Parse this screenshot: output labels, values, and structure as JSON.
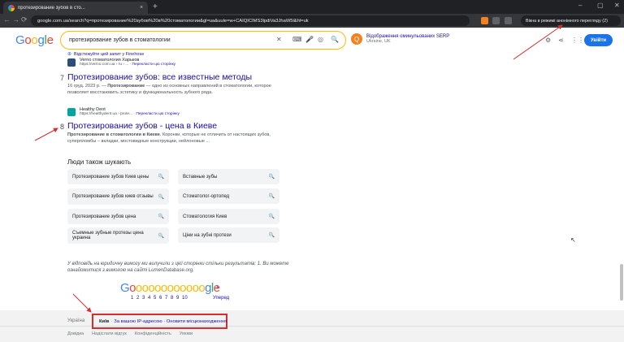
{
  "browser": {
    "tab_title": "протезирование зубов в сто...",
    "tab_close": "×",
    "new_tab": "+",
    "url": "google.com.ua/search?q=протезирование%20зубов%20в%20стоматологии&gl=ua&uule=w+CAIQICIMS3lpdiVa3JhaW5l&hl=uk",
    "incognito_label": "Вікна в режимі анонімного перегляду (2)",
    "window_min": "–",
    "window_max": "▢",
    "window_close": "✕",
    "back": "←",
    "forward": "→",
    "reload": "⟳",
    "info": "⊕"
  },
  "header": {
    "logo": [
      "G",
      "o",
      "o",
      "g",
      "l",
      "e"
    ],
    "logo_colors": [
      "#4285f4",
      "#ea4335",
      "#fbbc05",
      "#4285f4",
      "#34a853",
      "#ea4335"
    ],
    "query": "протезирование зубов в стоматологии",
    "serp_ext_ball": "Q",
    "serp_ext_title": "Відображення оминульованих SERP",
    "serp_ext_region": "Ukraine, UK",
    "login": "Увійти"
  },
  "results": {
    "finehose_note": "Відстежуйте цей запит у Finehose",
    "prev": {
      "site_name": "Verno стоматология Харьков",
      "site_url": "https://verno.com.ua › ru › ...",
      "translate": "Перекласти цю сторінку"
    },
    "r7": {
      "number": "7",
      "title": "Протезирование зубов: все известные методы",
      "date": "16 груд. 2023 р.",
      "snippet_bold": "Протезирование",
      "snippet": " — одно из основных направлений в стоматологии, которое позволяет восстановить эстетику и функциональность зубного ряда."
    },
    "r8": {
      "number": "8",
      "site_name": "Healthy Dent",
      "site_url": "https://healthydent.ua › prote...",
      "translate": "Перекласти цю сторінку",
      "title": "Протезирование зубов - цена в Киеве",
      "snippet_bold": "Протезирование в стоматологии в Киеве",
      "snippet": ". Коронки, которые не отличить от настоящих зубов, суперпломбы – вкладки, мостовидные конструкции, нейлоновые ..."
    }
  },
  "paa": {
    "title": "Люди також шукають",
    "items": [
      {
        "label": "Протезирование зубов Киев цены"
      },
      {
        "label": "Вставные зубы"
      },
      {
        "label": "Протезирование зубов киев отзывы"
      },
      {
        "label": "Стоматолог-ортопед"
      },
      {
        "label": "Протезирование зубов цена"
      },
      {
        "label": "Стоматология Киев"
      },
      {
        "label": "Съемные зубные протезы цена украина"
      },
      {
        "label": "Ціни на зубні протези"
      }
    ]
  },
  "notice": "У відповідь на юридичну вимогу ми вилучили з цієї сторінки стільки результатів: 1. Ви можете ознайомитися з вимогою на сайті LumenDatabase.org.",
  "pagination": {
    "letters": "Goooooooooooogle",
    "pages": "1 2 3 4 5 6 7 8 9 10",
    "next": "Уперед"
  },
  "footer": {
    "country": "Україна",
    "city": "Київ",
    "location_info": "За вашою IP-адресою · Оновити місцезнаходження",
    "links": [
      "Довідка",
      "Надіслати відгук",
      "Конфіденційність",
      "Умови"
    ]
  }
}
